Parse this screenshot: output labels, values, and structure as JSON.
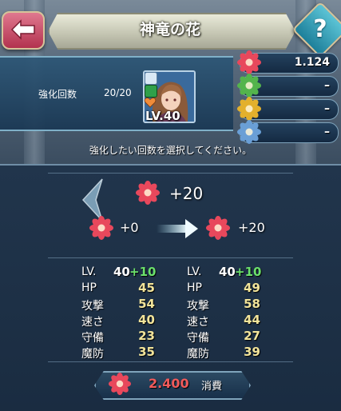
{
  "header": {
    "title": "神竜の花",
    "back_icon": "back-arrow-icon",
    "help_label": "?"
  },
  "unit": {
    "enhance_label": "強化回数",
    "enhance_count": "20/20",
    "level_text": "LV.40"
  },
  "currencies": [
    {
      "icon": "dragonflower-red-icon",
      "color": "#e8485c",
      "value": "1.124"
    },
    {
      "icon": "dragonflower-green-icon",
      "color": "#54b44c",
      "value": "–"
    },
    {
      "icon": "dragonflower-gold-icon",
      "color": "#e3b02c",
      "value": "–"
    },
    {
      "icon": "dragonflower-blue-icon",
      "color": "#6a9fd6",
      "value": "–"
    }
  ],
  "instruction": "強化したい回数を選択してください。",
  "selection": {
    "amount": "+20",
    "before": "+0",
    "after": "+20"
  },
  "stats_before": {
    "lv_label": "LV.",
    "lv_value": "40",
    "lv_bonus": "+10",
    "rows": [
      {
        "label": "HP",
        "value": "45"
      },
      {
        "label": "攻撃",
        "value": "54"
      },
      {
        "label": "速さ",
        "value": "40"
      },
      {
        "label": "守備",
        "value": "23"
      },
      {
        "label": "魔防",
        "value": "35"
      }
    ]
  },
  "stats_after": {
    "lv_label": "LV.",
    "lv_value": "40",
    "lv_bonus": "+10",
    "rows": [
      {
        "label": "HP",
        "value": "49"
      },
      {
        "label": "攻撃",
        "value": "58"
      },
      {
        "label": "速さ",
        "value": "44"
      },
      {
        "label": "守備",
        "value": "27"
      },
      {
        "label": "魔防",
        "value": "39"
      }
    ]
  },
  "cost": {
    "amount": "2.400",
    "label": "消費"
  },
  "colors": {
    "accent_red": "#e8485c",
    "stat_yellow": "#f2e49a",
    "bonus_green": "#6be06b",
    "cost_red": "#f05a5a"
  }
}
